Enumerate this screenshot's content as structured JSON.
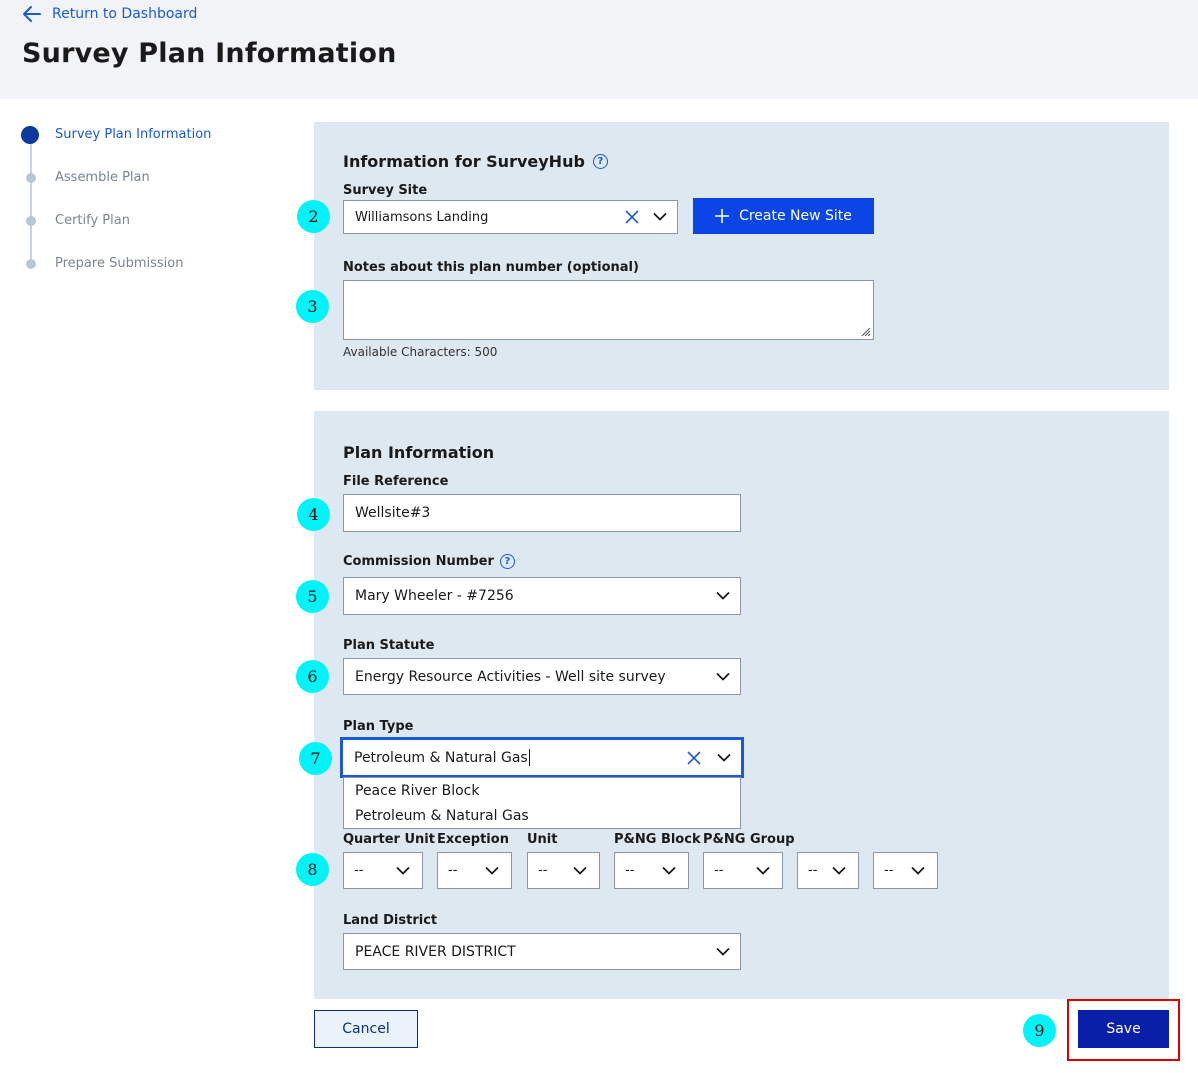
{
  "header": {
    "back_label": "Return to Dashboard",
    "title": "Survey Plan Information"
  },
  "stepper": {
    "steps": [
      {
        "label": "Survey Plan Information",
        "active": true
      },
      {
        "label": "Assemble Plan",
        "active": false
      },
      {
        "label": "Certify Plan",
        "active": false
      },
      {
        "label": "Prepare Submission",
        "active": false
      }
    ]
  },
  "surveyhub": {
    "title": "Information for SurveyHub",
    "site_label": "Survey Site",
    "site_value": "Williamsons Landing",
    "create_button": "Create New Site",
    "notes_label": "Notes about this plan number (optional)",
    "notes_value": "",
    "available_chars": "Available Characters: 500"
  },
  "plan_info": {
    "title": "Plan Information",
    "file_ref_label": "File Reference",
    "file_ref_value": "Wellsite#3",
    "commission_label": "Commission Number",
    "commission_value": "Mary Wheeler - #7256",
    "statute_label": "Plan Statute",
    "statute_value": "Energy Resource Activities - Well site survey",
    "plan_type_label": "Plan Type",
    "plan_type_value": "Petroleum & Natural Gas",
    "plan_type_options": [
      "Peace River Block",
      "Petroleum & Natural Gas"
    ],
    "location": {
      "quarter_unit_label": "Quarter Unit",
      "exception_label": "Exception",
      "unit_label": "Unit",
      "png_block_label": "P&NG Block",
      "png_group_label": "P&NG Group",
      "quarter_unit_value": "--",
      "exception_value": "--",
      "unit_value": "--",
      "png_block_value": "--",
      "png_group_value": "--",
      "extra1_value": "--",
      "extra2_value": "--"
    },
    "land_district_label": "Land District",
    "land_district_value": "PEACE RIVER DISTRICT"
  },
  "actions": {
    "cancel": "Cancel",
    "save": "Save"
  },
  "badges": [
    "2",
    "3",
    "4",
    "5",
    "6",
    "7",
    "8",
    "9"
  ],
  "colors": {
    "primary": "#0b45e5",
    "save": "#0a1fa8",
    "panel": "#dde8f1",
    "badge": "#00f3f6",
    "highlight": "#e00000"
  }
}
